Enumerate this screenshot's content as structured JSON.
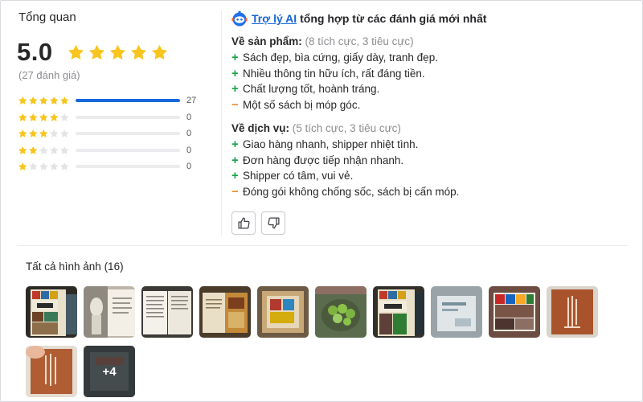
{
  "overview": {
    "title": "Tổng quan",
    "score": "5.0",
    "stars": 5,
    "count_text": "(27 đánh giá)",
    "star_color": "#f7c51e",
    "empty_star_color": "#e4e4e7",
    "bar_color": "#1668dc",
    "breakdown": [
      {
        "stars": 5,
        "count": "27",
        "fraction": 1.0
      },
      {
        "stars": 4,
        "count": "0",
        "fraction": 0
      },
      {
        "stars": 3,
        "count": "0",
        "fraction": 0
      },
      {
        "stars": 2,
        "count": "0",
        "fraction": 0
      },
      {
        "stars": 1,
        "count": "0",
        "fraction": 0
      }
    ]
  },
  "ai_summary": {
    "icon": "robot-icon",
    "link_label": "Trợ lý AI",
    "heading_rest": "tổng hợp từ các đánh giá mới nhất",
    "product": {
      "title": "Về sản phẩm:",
      "subtitle": "(8 tích cực, 3 tiêu cực)",
      "items": [
        {
          "sign": "+",
          "text": "Sách đẹp, bìa cứng, giấy dày, tranh đẹp."
        },
        {
          "sign": "+",
          "text": "Nhiều thông tin hữu ích, rất đáng tiền."
        },
        {
          "sign": "+",
          "text": "Chất lượng tốt, hoành tráng."
        },
        {
          "sign": "−",
          "text": "Một số sách bị móp góc."
        }
      ]
    },
    "service": {
      "title": "Về dịch vụ:",
      "subtitle": "(5 tích cực, 3 tiêu cực)",
      "items": [
        {
          "sign": "+",
          "text": "Giao hàng nhanh, shipper nhiệt tình."
        },
        {
          "sign": "+",
          "text": "Đơn hàng được tiếp nhận nhanh."
        },
        {
          "sign": "+",
          "text": "Shipper có tâm, vui vẻ."
        },
        {
          "sign": "−",
          "text": "Đóng gói không chống sốc, sách bị cấn móp."
        }
      ]
    },
    "feedback": {
      "like_icon": "thumbs-up-icon",
      "dislike_icon": "thumbs-down-icon"
    }
  },
  "images": {
    "title": "Tất cả hình ảnh (16)",
    "more_label": "+4",
    "thumbnails": [
      {
        "name": "book-cover-art-photo"
      },
      {
        "name": "statue-page-photo"
      },
      {
        "name": "open-book-text-photo"
      },
      {
        "name": "open-book-illustration-photo"
      },
      {
        "name": "book-box-photo"
      },
      {
        "name": "book-plants-photo"
      },
      {
        "name": "book-cover-art-photo-2"
      },
      {
        "name": "wrapped-book-photo"
      },
      {
        "name": "book-tiles-photo"
      },
      {
        "name": "story-of-art-cover-photo"
      },
      {
        "name": "story-of-art-hand-photo"
      },
      {
        "name": "book-back-cover-photo"
      },
      {
        "name": "more-images-photo"
      }
    ]
  }
}
